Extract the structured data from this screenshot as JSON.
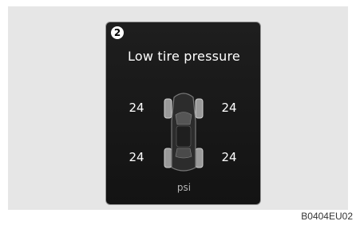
{
  "display": {
    "step_number": "2",
    "title": "Low tire pressure",
    "tires": {
      "front_left": "24",
      "front_right": "24",
      "rear_left": "24",
      "rear_right": "24"
    },
    "unit": "psi"
  },
  "figure_code": "B0404EU02",
  "icons": {
    "car": "car-top-view-icon"
  }
}
